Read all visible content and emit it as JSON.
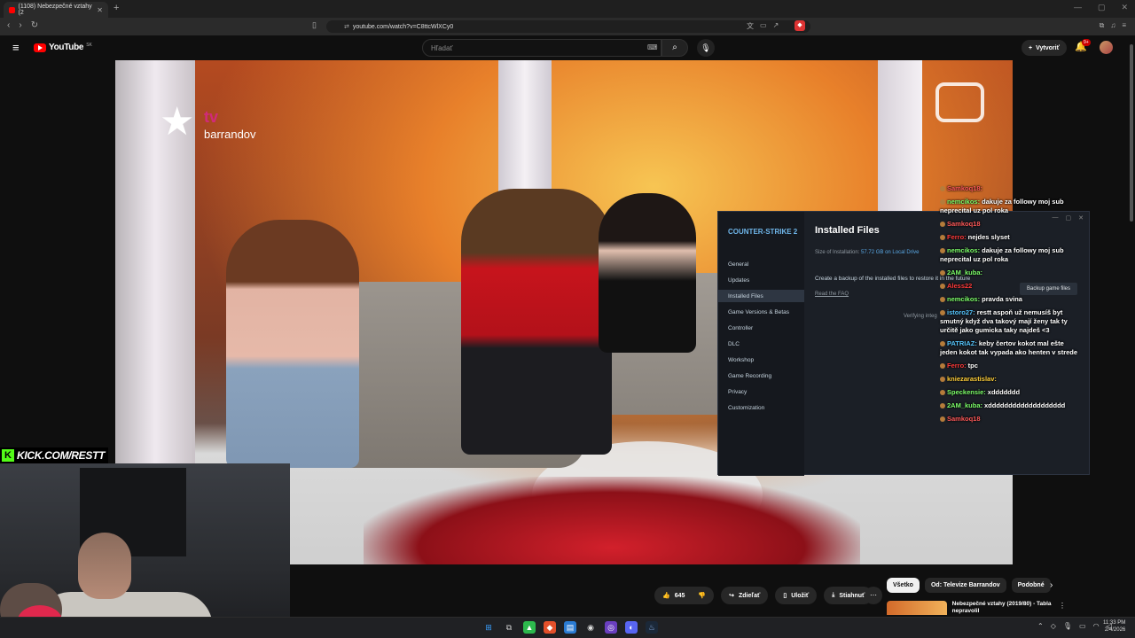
{
  "browser": {
    "tab_title": "(1108) Nebezpečné vztahy (2",
    "tab_close": "✕",
    "new_tab": "+",
    "url_site": "⇄",
    "url": "youtube.com/watch?v=C8ttcWlXCy0",
    "window_controls": [
      "—",
      "▢",
      "✕"
    ]
  },
  "youtube": {
    "logo_text": "YouTube",
    "region": "SK",
    "search_placeholder": "Hľadať",
    "create_label": "Vytvoriť",
    "notif_count": "9+"
  },
  "video": {
    "channel_logo_tv": "tv",
    "channel_logo_brand": "barrandov"
  },
  "steam": {
    "game_title": "COUNTER-STRIKE 2",
    "nav": [
      "General",
      "Updates",
      "Installed Files",
      "Game Versions & Betas",
      "Controller",
      "DLC",
      "Workshop",
      "Game Recording",
      "Privacy",
      "Customization"
    ],
    "selected_nav": "Installed Files",
    "title": "Installed Files",
    "size_label": "Size of Installation:",
    "size_value": "57.72 GB on Local Drive",
    "backup_desc": "Create a backup of the installed files to restore it in the future",
    "faq_link": "Read the FAQ",
    "backup_button": "Backup game files",
    "verifying": "Verifying integ"
  },
  "chat": [
    {
      "user": "Samkoq18:",
      "text": "",
      "color": "#ff5a5a"
    },
    {
      "user": "nemcikos:",
      "text": "dakuje za followy moj sub neprecital uz pol roka",
      "color": "#7dff6a"
    },
    {
      "user": "Samkoq18",
      "text": "",
      "color": "#ff5a5a"
    },
    {
      "user": "Ferro:",
      "text": "nejdes slyset",
      "color": "#ff3b3b"
    },
    {
      "user": "nemcikos:",
      "text": "dakuje za followy moj sub neprecital uz pol roka",
      "color": "#7dff6a"
    },
    {
      "user": "2AM_kuba:",
      "text": "",
      "color": "#7dff6a"
    },
    {
      "user": "Aless22",
      "text": "",
      "color": "#ff3b3b"
    },
    {
      "user": "nemcikos:",
      "text": "pravda svina",
      "color": "#7dff6a"
    },
    {
      "user": "istoro27:",
      "text": "restt aspoň už nemusíš byt smutný když dva takový mají ženy tak ty určitě jako gumicka taky najdeš <3",
      "color": "#56c7ff"
    },
    {
      "user": "PATRIAZ:",
      "text": "keby čertov kokot mal ešte jeden kokot tak vypada ako henten v strede",
      "color": "#56c7ff"
    },
    {
      "user": "Ferro:",
      "text": "tpc",
      "color": "#ff3b3b"
    },
    {
      "user": "kniezarastislav:",
      "text": "",
      "color": "#ffcf3b"
    },
    {
      "user": "Speckensie:",
      "text": "xddddddd",
      "color": "#7dff6a"
    },
    {
      "user": "2AM_kuba:",
      "text": "xddddddddddddddddddd",
      "color": "#7dff6a"
    },
    {
      "user": "Samkoq18",
      "text": "",
      "color": "#ff5a5a"
    }
  ],
  "webcam": {
    "kick_k": "K",
    "kick_text": "KICK.COM/RESTT"
  },
  "actions": {
    "like_count": "645",
    "share": "Zdieľať",
    "save": "Uložiť",
    "download": "Stiahnuť"
  },
  "chips": [
    "Všetko",
    "Od: Televize Barrandov",
    "Podobné"
  ],
  "recommendation": {
    "title": "Nebezpečné vztahy (2019/80) - Tabla nepravolil"
  },
  "taskbar": {
    "time": "11:33 PM",
    "date": "2/4/2026"
  }
}
